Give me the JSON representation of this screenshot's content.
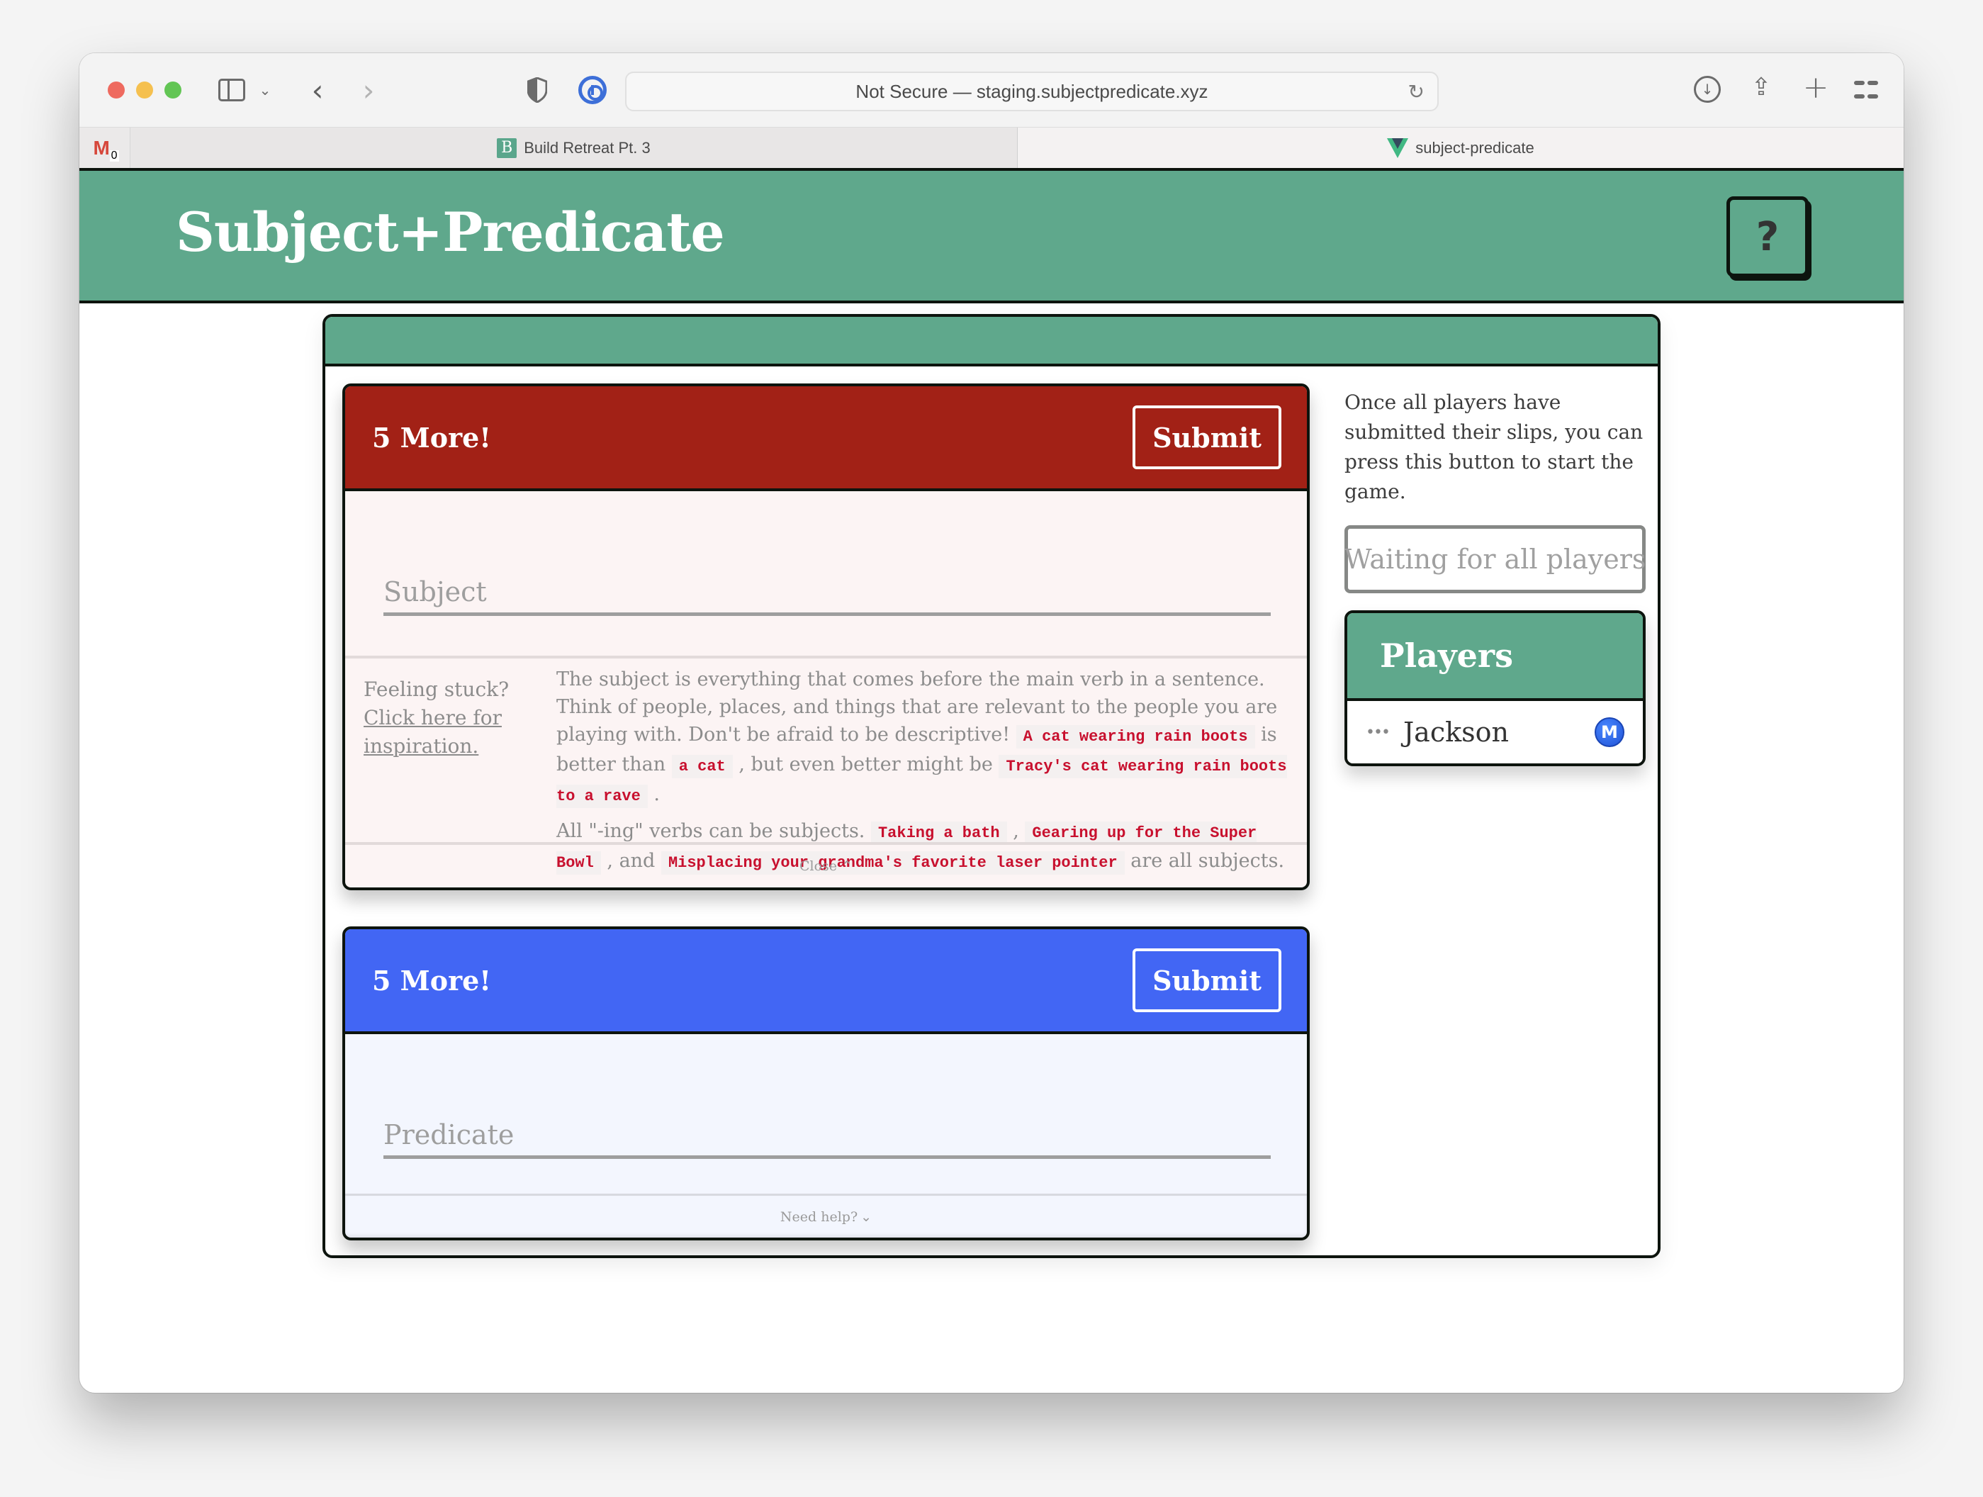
{
  "browser": {
    "url_text": "Not Secure — staging.subjectpredicate.xyz",
    "pinned_tab": {
      "icon": "gmail-icon",
      "badge": "0"
    },
    "tabs": [
      {
        "label": "Build Retreat Pt. 3",
        "favicon_letter": "B",
        "active": false
      },
      {
        "label": "subject-predicate",
        "active": true
      }
    ],
    "toolbar_glyphs": {
      "back": "‹",
      "forward": "›",
      "chevron": "⌄",
      "reload": "↻",
      "download": "↓",
      "share": "⇪",
      "new_tab": "+"
    }
  },
  "header": {
    "title": "Subject+Predicate",
    "help_label": "?"
  },
  "slips": {
    "subject": {
      "count_label": "5 More!",
      "submit_label": "Submit",
      "input_placeholder": "Subject",
      "input_value": "",
      "color": "#a22116",
      "help": {
        "stuck_label": "Feeling stuck?",
        "inspiration_link": "Click here for inspiration.",
        "p1": {
          "t1": "The subject is everything that comes before the main verb in a sentence. Think of people, places, and things that are relevant to the people you are playing with. Don't be afraid to be descriptive!",
          "c1": "A cat wearing rain boots",
          "t2": "is better than",
          "c2": "a cat",
          "t3": ", but even better might be",
          "c3": "Tracy's cat wearing rain boots to a rave",
          "t4": "."
        },
        "p2": {
          "t1": "All \"-ing\" verbs can be subjects.",
          "c1": "Taking a bath",
          "t2": ",",
          "c2": "Gearing up for the Super Bowl",
          "t3": ", and",
          "c3": "Misplacing your grandma's favorite laser pointer",
          "t4": "are all subjects."
        },
        "close_label": "Close",
        "close_icon": "⌃"
      }
    },
    "predicate": {
      "count_label": "5 More!",
      "submit_label": "Submit",
      "input_placeholder": "Predicate",
      "input_value": "",
      "color": "#4266f4",
      "need_help_label": "Need help?",
      "need_help_icon": "⌄"
    }
  },
  "side": {
    "instructions": "Once all players have submitted their slips, you can press this button to start the game.",
    "start_button_label": "Waiting for all players",
    "players_title": "Players",
    "players": [
      {
        "name": "Jackson",
        "status": "•••",
        "badge": "M"
      }
    ]
  },
  "colors": {
    "brand_green": "#5fa88c",
    "subject_red": "#a22116",
    "predicate_blue": "#4266f4",
    "code_red": "#c8102e"
  }
}
